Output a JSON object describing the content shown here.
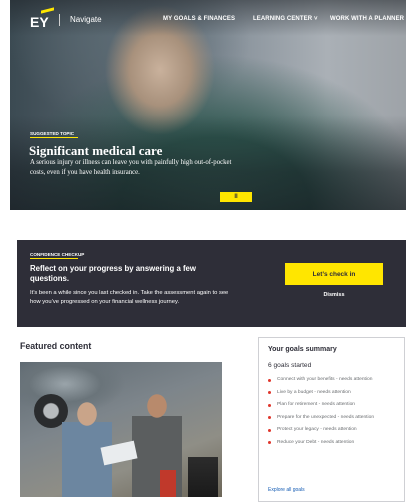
{
  "nav": {
    "logo": "EY",
    "brand": "Navigate",
    "links": [
      "MY GOALS & FINANCES",
      "LEARNING CENTER",
      "WORK WITH A PLANNER"
    ],
    "dropdown_glyph": "˅"
  },
  "hero": {
    "tag": "SUGGESTED TOPIC",
    "title": "Significant medical care",
    "description": "A serious injury or illness can leave you with painfully high out-of-pocket costs, even if you have health insurance.",
    "pause_glyph": "II"
  },
  "checkup": {
    "tag": "CONFIDENCE CHECKUP",
    "title": "Reflect on your progress by answering a few questions.",
    "description": "It’s been a while since you last checked in. Take the assessment again to see how you’ve progressed on your financial wellness journey.",
    "button": "Let’s check in",
    "dismiss": "Dismiss"
  },
  "featured": {
    "title": "Featured content"
  },
  "goals": {
    "title": "Your goals summary",
    "count": "6 goals started",
    "items": [
      "Connect with your benefits - needs attention",
      "Live by a budget - needs attention",
      "Plan for retirement - needs attention",
      "Prepare for the unexpected - needs attention",
      "Protect your legacy - needs attention",
      "Reduce your Debt - needs attention"
    ],
    "explore": "Explore all goals"
  },
  "colors": {
    "brand_yellow": "#ffe600",
    "dark": "#2e2e38",
    "status_red": "#e0362c",
    "link_blue": "#155cb4"
  }
}
